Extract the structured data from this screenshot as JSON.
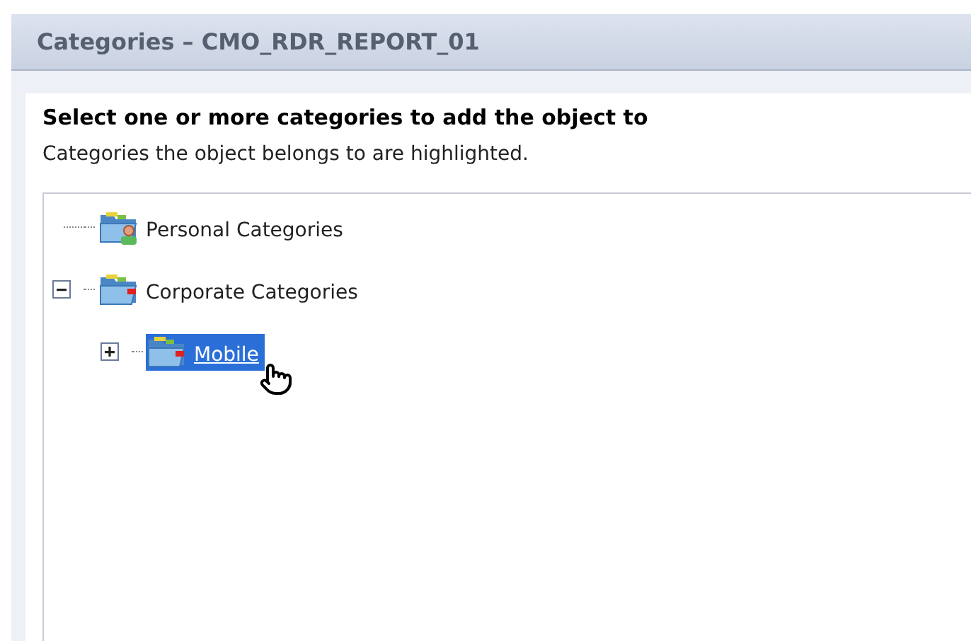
{
  "dialog": {
    "title": "Categories – CMO_RDR_REPORT_01"
  },
  "heading": "Select one or more categories to add the object to",
  "hint": "Categories the object belongs to are highlighted.",
  "tree": [
    {
      "label": "Personal Categories",
      "kind": "personal",
      "selected": false
    },
    {
      "label": "Corporate Categories",
      "kind": "corporate",
      "selected": false,
      "expanded": true,
      "children": [
        {
          "label": "Mobile",
          "kind": "corporate",
          "selected": true,
          "expanded": false
        }
      ]
    }
  ]
}
